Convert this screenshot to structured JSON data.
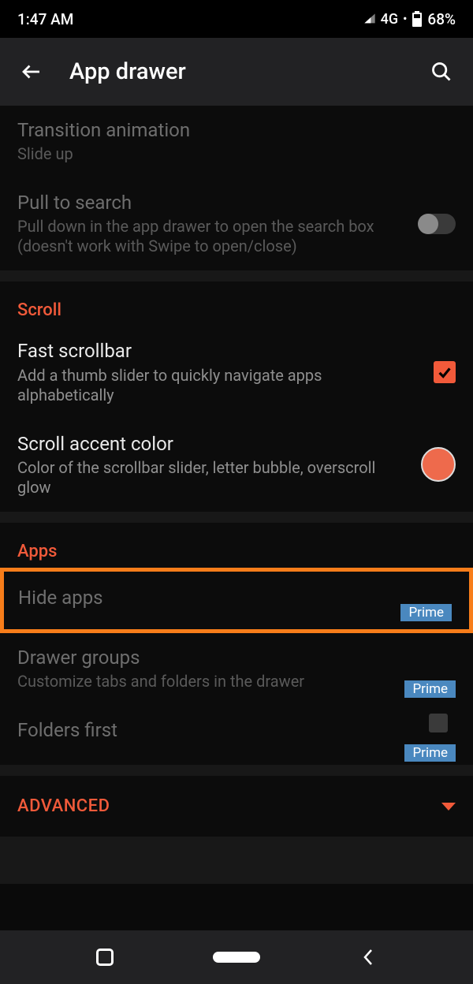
{
  "status": {
    "time": "1:47 AM",
    "network": "4G",
    "battery": "68%"
  },
  "appbar": {
    "title": "App drawer"
  },
  "sections": {
    "transition": {
      "label": "Transition animation",
      "value": "Slide up"
    },
    "pullsearch": {
      "label": "Pull to search",
      "sub": "Pull down in the app drawer to open the search box (doesn't work with Swipe to open/close)"
    },
    "scroll_header": "Scroll",
    "fastscroll": {
      "label": "Fast scrollbar",
      "sub": "Add a thumb slider to quickly navigate apps alphabetically"
    },
    "accent": {
      "label": "Scroll accent color",
      "sub": "Color of the scrollbar slider, letter bubble, overscroll glow",
      "color": "#ee6a4c"
    },
    "apps_header": "Apps",
    "hideapps": {
      "label": "Hide apps",
      "badge": "Prime"
    },
    "drawergroups": {
      "label": "Drawer groups",
      "sub": "Customize tabs and folders in the drawer",
      "badge": "Prime"
    },
    "foldersfirst": {
      "label": "Folders first",
      "badge": "Prime"
    },
    "advanced": "ADVANCED"
  }
}
